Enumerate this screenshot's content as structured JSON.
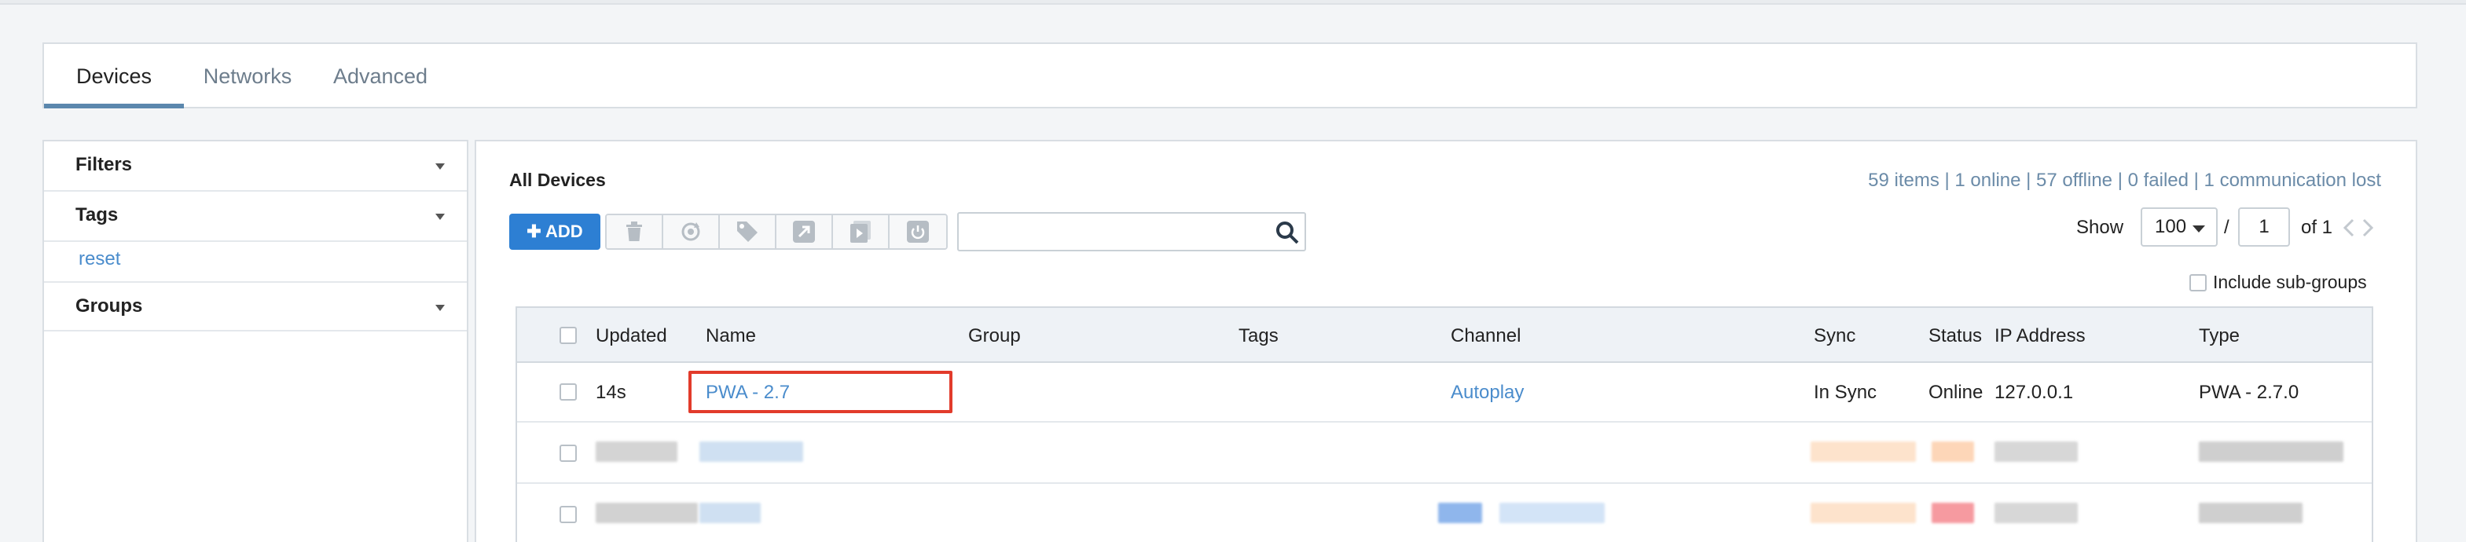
{
  "tabs": [
    {
      "label": "Devices",
      "active": true
    },
    {
      "label": "Networks",
      "active": false
    },
    {
      "label": "Advanced",
      "active": false
    }
  ],
  "sidebar": {
    "filters": "Filters",
    "tags": "Tags",
    "reset": "reset",
    "groups": "Groups"
  },
  "main": {
    "title": "All Devices",
    "summary": "59 items | 1 online | 57 offline | 0 failed | 1 communication lost",
    "add_label": "ADD",
    "toolbar_icons": [
      "trash-icon",
      "sync-icon",
      "tag-icon",
      "external-link-icon",
      "play-icon",
      "power-icon"
    ],
    "search": {
      "value": "",
      "placeholder": ""
    },
    "pagination": {
      "show_label": "Show",
      "per_page": "100",
      "slash": "/",
      "page": "1",
      "of_label": "of 1"
    },
    "include_subgroups": "Include sub-groups"
  },
  "table": {
    "columns": [
      "Updated",
      "Name",
      "Group",
      "Tags",
      "Channel",
      "Sync",
      "Status",
      "IP Address",
      "Type"
    ],
    "rows": [
      {
        "updated": "14s",
        "name": "PWA - 2.7",
        "group": "",
        "tags": "",
        "channel": "Autoplay",
        "sync": "In Sync",
        "status": "Online",
        "ip": "127.0.0.1",
        "type": "PWA - 2.7.0"
      }
    ]
  },
  "colors": {
    "accent": "#2d7fd3",
    "link": "#4a8ccc",
    "highlight": "#e23b2b",
    "tab_underline": "#5b87ad"
  }
}
